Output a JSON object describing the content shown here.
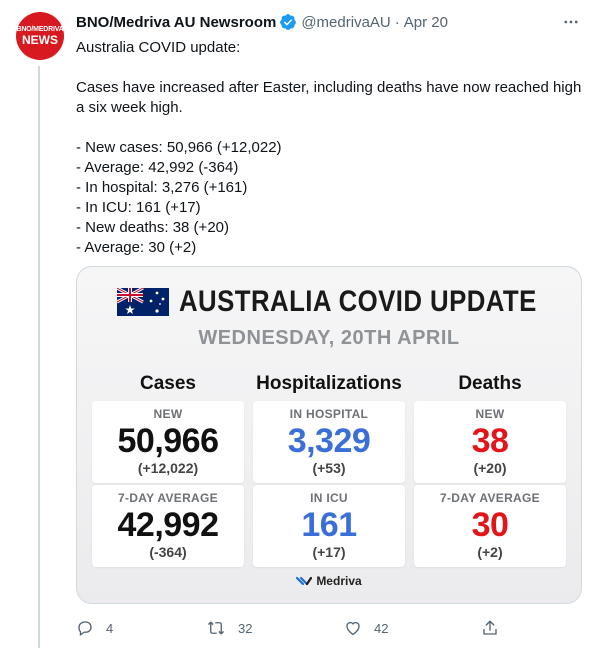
{
  "tweet": {
    "avatar": {
      "line1": "BNO/MEDRIVA",
      "line2": "NEWS",
      "color": "#d71920"
    },
    "author_name": "BNO/Medriva AU Newsroom",
    "handle": "@medrivaAU",
    "separator": "·",
    "date": "Apr 20",
    "text": {
      "line1": "Australia COVID update:",
      "line2": "Cases have increased after Easter, including deaths have now reached high a six week high.",
      "bullets": [
        "- New cases: 50,966 (+12,022)",
        "- Average: 42,992 (-364)",
        "- In hospital: 3,276 (+161)",
        "- In ICU: 161 (+17)",
        "- New deaths: 38 (+20)",
        "- Average: 30 (+2)"
      ]
    },
    "media": {
      "title": "AUSTRALIA COVID UPDATE",
      "date": "WEDNESDAY, 20TH APRIL",
      "columns": [
        {
          "heading": "Cases",
          "color": "#111111",
          "cards": [
            {
              "label": "NEW",
              "value": "50,966",
              "change": "(+12,022)"
            },
            {
              "label": "7-DAY AVERAGE",
              "value": "42,992",
              "change": "(-364)"
            }
          ]
        },
        {
          "heading": "Hospitalizations",
          "color": "#3a6fd8",
          "cards": [
            {
              "label": "IN HOSPITAL",
              "value": "3,329",
              "change": "(+53)"
            },
            {
              "label": "IN ICU",
              "value": "161",
              "change": "(+17)"
            }
          ]
        },
        {
          "heading": "Deaths",
          "color": "#e4141b",
          "cards": [
            {
              "label": "NEW",
              "value": "38",
              "change": "(+20)"
            },
            {
              "label": "7-DAY AVERAGE",
              "value": "30",
              "change": "(+2)"
            }
          ]
        }
      ],
      "brand": "Medriva"
    },
    "actions": {
      "reply": {
        "icon": "reply-icon",
        "count": "4"
      },
      "retweet": {
        "icon": "retweet-icon",
        "count": "32"
      },
      "like": {
        "icon": "heart-icon",
        "count": "42"
      },
      "share": {
        "icon": "share-icon"
      }
    }
  }
}
